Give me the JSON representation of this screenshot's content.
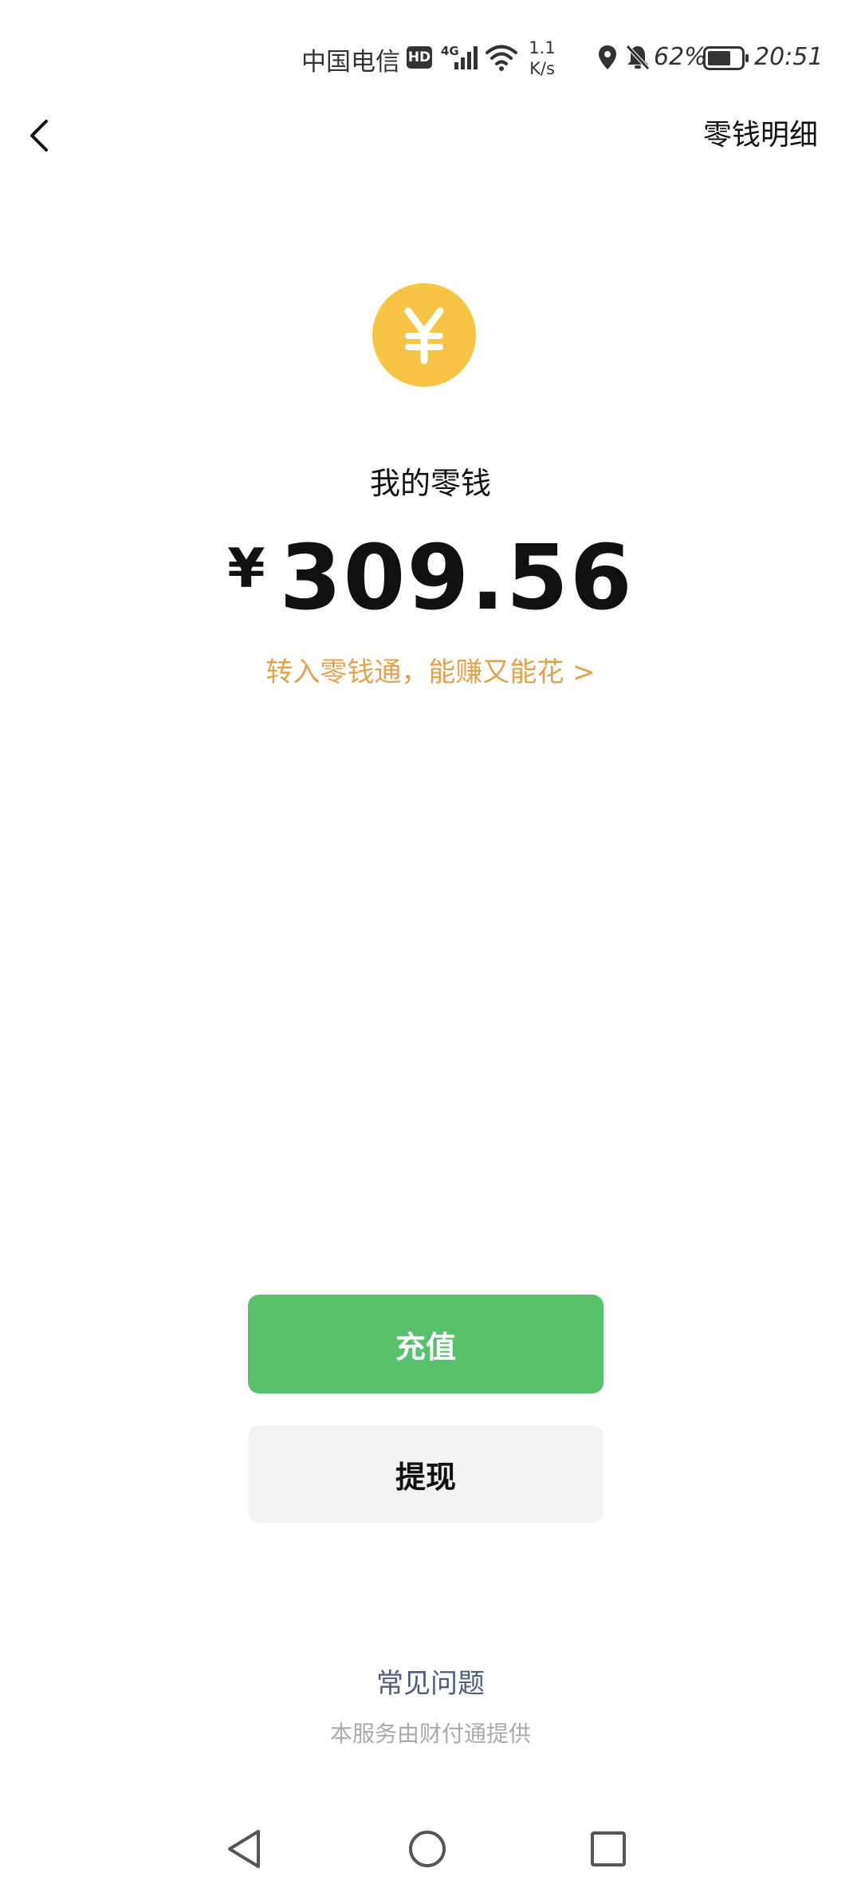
{
  "status_bar": {
    "carrier": "中国电信",
    "hd_badge": "HD",
    "network_type": "4G",
    "net_speed_value": "1.1",
    "net_speed_unit": "K/s",
    "battery_percent": "62%",
    "time": "20:51",
    "icons": [
      "signal-icon",
      "wifi-icon",
      "location-icon",
      "bell-off-icon",
      "battery-icon"
    ]
  },
  "header": {
    "back_icon": "chevron-left-icon",
    "details_label": "零钱明细"
  },
  "wallet": {
    "coin_icon": "yuan-coin-icon",
    "label": "我的零钱",
    "currency_symbol": "¥",
    "balance": "309.56",
    "promo_text": "转入零钱通，能赚又能花 >"
  },
  "actions": {
    "recharge_label": "充值",
    "withdraw_label": "提现"
  },
  "footer": {
    "faq_label": "常见问题",
    "provider_note": "本服务由财付通提供"
  },
  "colors": {
    "accent_green": "#58c16b",
    "coin_yellow": "#f6c445",
    "promo_orange": "#e3a14b",
    "faq_blue": "#4e5d86",
    "secondary_bg": "#f2f2f2"
  },
  "system_nav": {
    "icons": [
      "nav-back-icon",
      "nav-home-icon",
      "nav-recents-icon"
    ]
  }
}
